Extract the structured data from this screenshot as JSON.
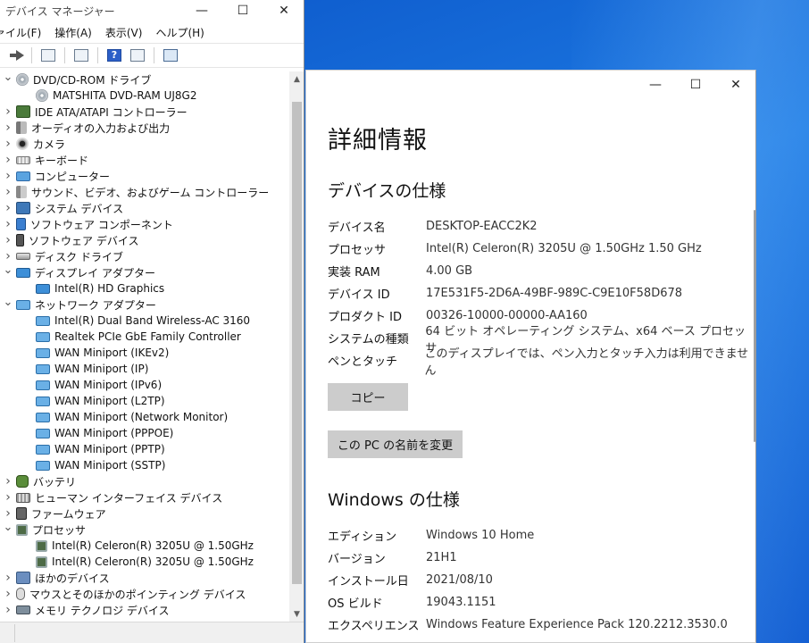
{
  "device_manager": {
    "title": "デバイス マネージャー",
    "menu": [
      "ァイル(F)",
      "操作(A)",
      "表示(V)",
      "ヘルプ(H)"
    ],
    "toolbar_icons": [
      "back-arrow-icon",
      "properties-icon",
      "update-driver-icon",
      "help-icon",
      "view-icon",
      "monitor-icon"
    ],
    "tree": [
      {
        "label": "DVD/CD-ROM ドライブ",
        "expanded": true,
        "icon": "disk",
        "children": [
          {
            "label": "MATSHITA DVD-RAM UJ8G2",
            "icon": "disk"
          }
        ]
      },
      {
        "label": "IDE ATA/ATAPI コントローラー",
        "expanded": false,
        "icon": "ide"
      },
      {
        "label": "オーディオの入力および出力",
        "expanded": false,
        "icon": "audio"
      },
      {
        "label": "カメラ",
        "expanded": false,
        "icon": "camera"
      },
      {
        "label": "キーボード",
        "expanded": false,
        "icon": "keyboard"
      },
      {
        "label": "コンピューター",
        "expanded": false,
        "icon": "computer"
      },
      {
        "label": "サウンド、ビデオ、およびゲーム コントローラー",
        "expanded": false,
        "icon": "sound"
      },
      {
        "label": "システム デバイス",
        "expanded": false,
        "icon": "system"
      },
      {
        "label": "ソフトウェア コンポーネント",
        "expanded": false,
        "icon": "sw"
      },
      {
        "label": "ソフトウェア デバイス",
        "expanded": false,
        "icon": "swdev"
      },
      {
        "label": "ディスク ドライブ",
        "expanded": false,
        "icon": "drive"
      },
      {
        "label": "ディスプレイ アダプター",
        "expanded": true,
        "icon": "display",
        "children": [
          {
            "label": "Intel(R) HD Graphics",
            "icon": "display"
          }
        ]
      },
      {
        "label": "ネットワーク アダプター",
        "expanded": true,
        "icon": "network",
        "children": [
          {
            "label": "Intel(R) Dual Band Wireless-AC 3160",
            "icon": "network"
          },
          {
            "label": "Realtek PCIe GbE Family Controller",
            "icon": "network"
          },
          {
            "label": "WAN Miniport (IKEv2)",
            "icon": "network"
          },
          {
            "label": "WAN Miniport (IP)",
            "icon": "network"
          },
          {
            "label": "WAN Miniport (IPv6)",
            "icon": "network"
          },
          {
            "label": "WAN Miniport (L2TP)",
            "icon": "network"
          },
          {
            "label": "WAN Miniport (Network Monitor)",
            "icon": "network"
          },
          {
            "label": "WAN Miniport (PPPOE)",
            "icon": "network"
          },
          {
            "label": "WAN Miniport (PPTP)",
            "icon": "network"
          },
          {
            "label": "WAN Miniport (SSTP)",
            "icon": "network"
          }
        ]
      },
      {
        "label": "バッテリ",
        "expanded": false,
        "icon": "battery"
      },
      {
        "label": "ヒューマン インターフェイス デバイス",
        "expanded": false,
        "icon": "hid"
      },
      {
        "label": "ファームウェア",
        "expanded": false,
        "icon": "firmware"
      },
      {
        "label": "プロセッサ",
        "expanded": true,
        "icon": "cpu",
        "children": [
          {
            "label": "Intel(R) Celeron(R) 3205U @ 1.50GHz",
            "icon": "cpu"
          },
          {
            "label": "Intel(R) Celeron(R) 3205U @ 1.50GHz",
            "icon": "cpu"
          }
        ]
      },
      {
        "label": "ほかのデバイス",
        "expanded": false,
        "icon": "other"
      },
      {
        "label": "マウスとそのほかのポインティング デバイス",
        "expanded": false,
        "icon": "mouse"
      },
      {
        "label": "メモリ テクノロジ デバイス",
        "expanded": false,
        "icon": "memory"
      }
    ]
  },
  "about": {
    "heading": "詳細情報",
    "device_spec_heading": "デバイスの仕様",
    "device_specs": [
      {
        "label": "デバイス名",
        "value": "DESKTOP-EACC2K2"
      },
      {
        "label": "プロセッサ",
        "value": "Intel(R) Celeron(R) 3205U @ 1.50GHz   1.50 GHz"
      },
      {
        "label": "実装 RAM",
        "value": "4.00 GB"
      },
      {
        "label": "デバイス ID",
        "value": "17E531F5-2D6A-49BF-989C-C9E10F58D678"
      },
      {
        "label": "プロダクト ID",
        "value": "00326-10000-00000-AA160"
      },
      {
        "label": "システムの種類",
        "value": "64 ビット オペレーティング システム、x64 ベース プロセッサ"
      },
      {
        "label": "ペンとタッチ",
        "value": "このディスプレイでは、ペン入力とタッチ入力は利用できません"
      }
    ],
    "copy_button": "コピー",
    "rename_button": "この PC の名前を変更",
    "windows_spec_heading": "Windows の仕様",
    "windows_specs": [
      {
        "label": "エディション",
        "value": "Windows 10 Home"
      },
      {
        "label": "バージョン",
        "value": "21H1"
      },
      {
        "label": "インストール日",
        "value": "2021/08/10"
      },
      {
        "label": "OS ビルド",
        "value": "19043.1151"
      },
      {
        "label": "エクスペリエンス",
        "value": "Windows Feature Experience Pack 120.2212.3530.0"
      }
    ]
  },
  "window_controls": {
    "minimize": "—",
    "maximize": "☐",
    "close": "✕"
  }
}
